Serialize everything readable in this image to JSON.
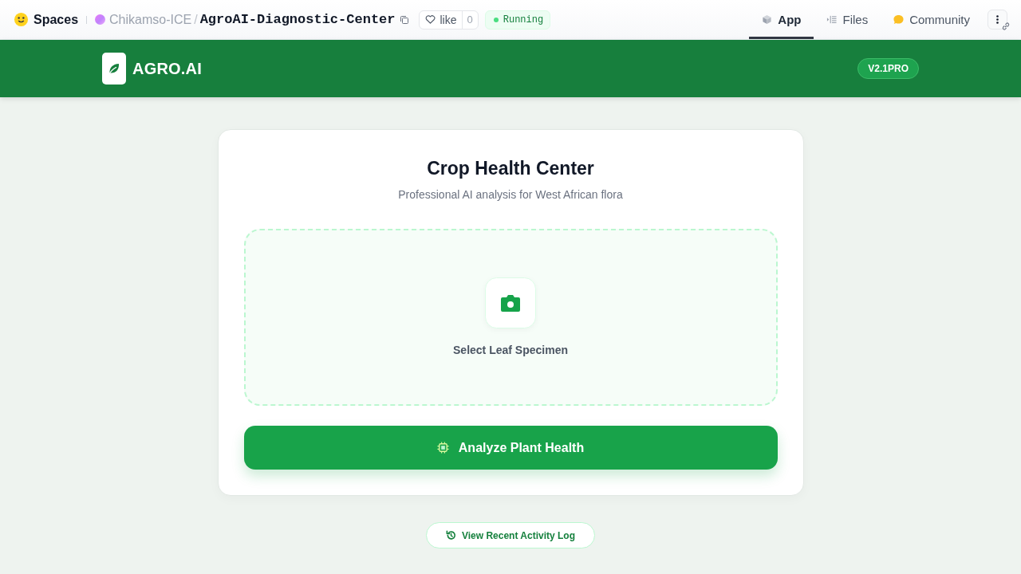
{
  "hf_header": {
    "brand": "Spaces",
    "owner": "Chikamso-ICE",
    "separator": "/",
    "space_name": "AgroAI-Diagnostic-Center",
    "like": {
      "label": "like",
      "count": "0"
    },
    "status": "Running",
    "tabs": [
      {
        "kind": "app",
        "label": "App",
        "selected": true
      },
      {
        "kind": "files",
        "label": "Files",
        "selected": false
      },
      {
        "kind": "community",
        "label": "Community",
        "selected": false
      }
    ]
  },
  "app_bar": {
    "logo": "AGRO.AI",
    "version": "V2.1PRO"
  },
  "card": {
    "title": "Crop Health Center",
    "subtitle": "Professional AI analysis for West African flora",
    "upload_label": "Select Leaf Specimen",
    "analyze_button": "Analyze Plant Health"
  },
  "activity_button": "View Recent Activity Log"
}
